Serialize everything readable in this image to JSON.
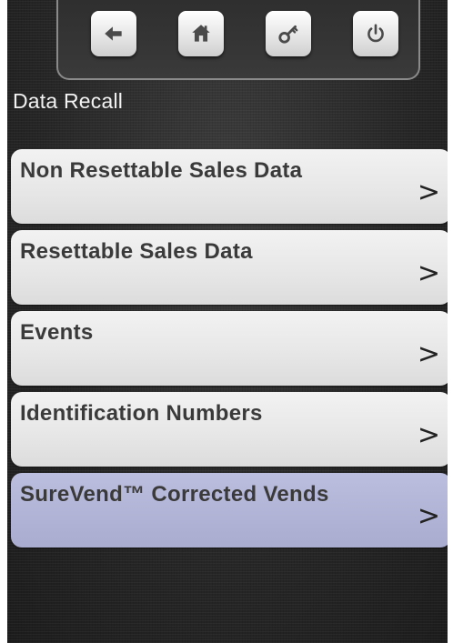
{
  "toolbar": {
    "back_icon": "arrow-left-icon",
    "home_icon": "home-icon",
    "key_icon": "key-icon",
    "power_icon": "power-icon"
  },
  "page": {
    "title": "Data Recall"
  },
  "menu": {
    "items": [
      {
        "label": "Non Resettable Sales Data",
        "chevron": ">"
      },
      {
        "label": "Resettable Sales Data",
        "chevron": ">"
      },
      {
        "label": "Events",
        "chevron": ">"
      },
      {
        "label": "Identification Numbers",
        "chevron": ">"
      },
      {
        "label": "SureVend™ Corrected Vends",
        "chevron": ">",
        "highlighted": true
      }
    ]
  },
  "colors": {
    "background": "#2a2a2a",
    "item_bg": "#e6e6e6",
    "item_highlight_bg": "#b1b3d6",
    "title_text": "#f2f2f2",
    "item_text": "#3a3a3a"
  }
}
